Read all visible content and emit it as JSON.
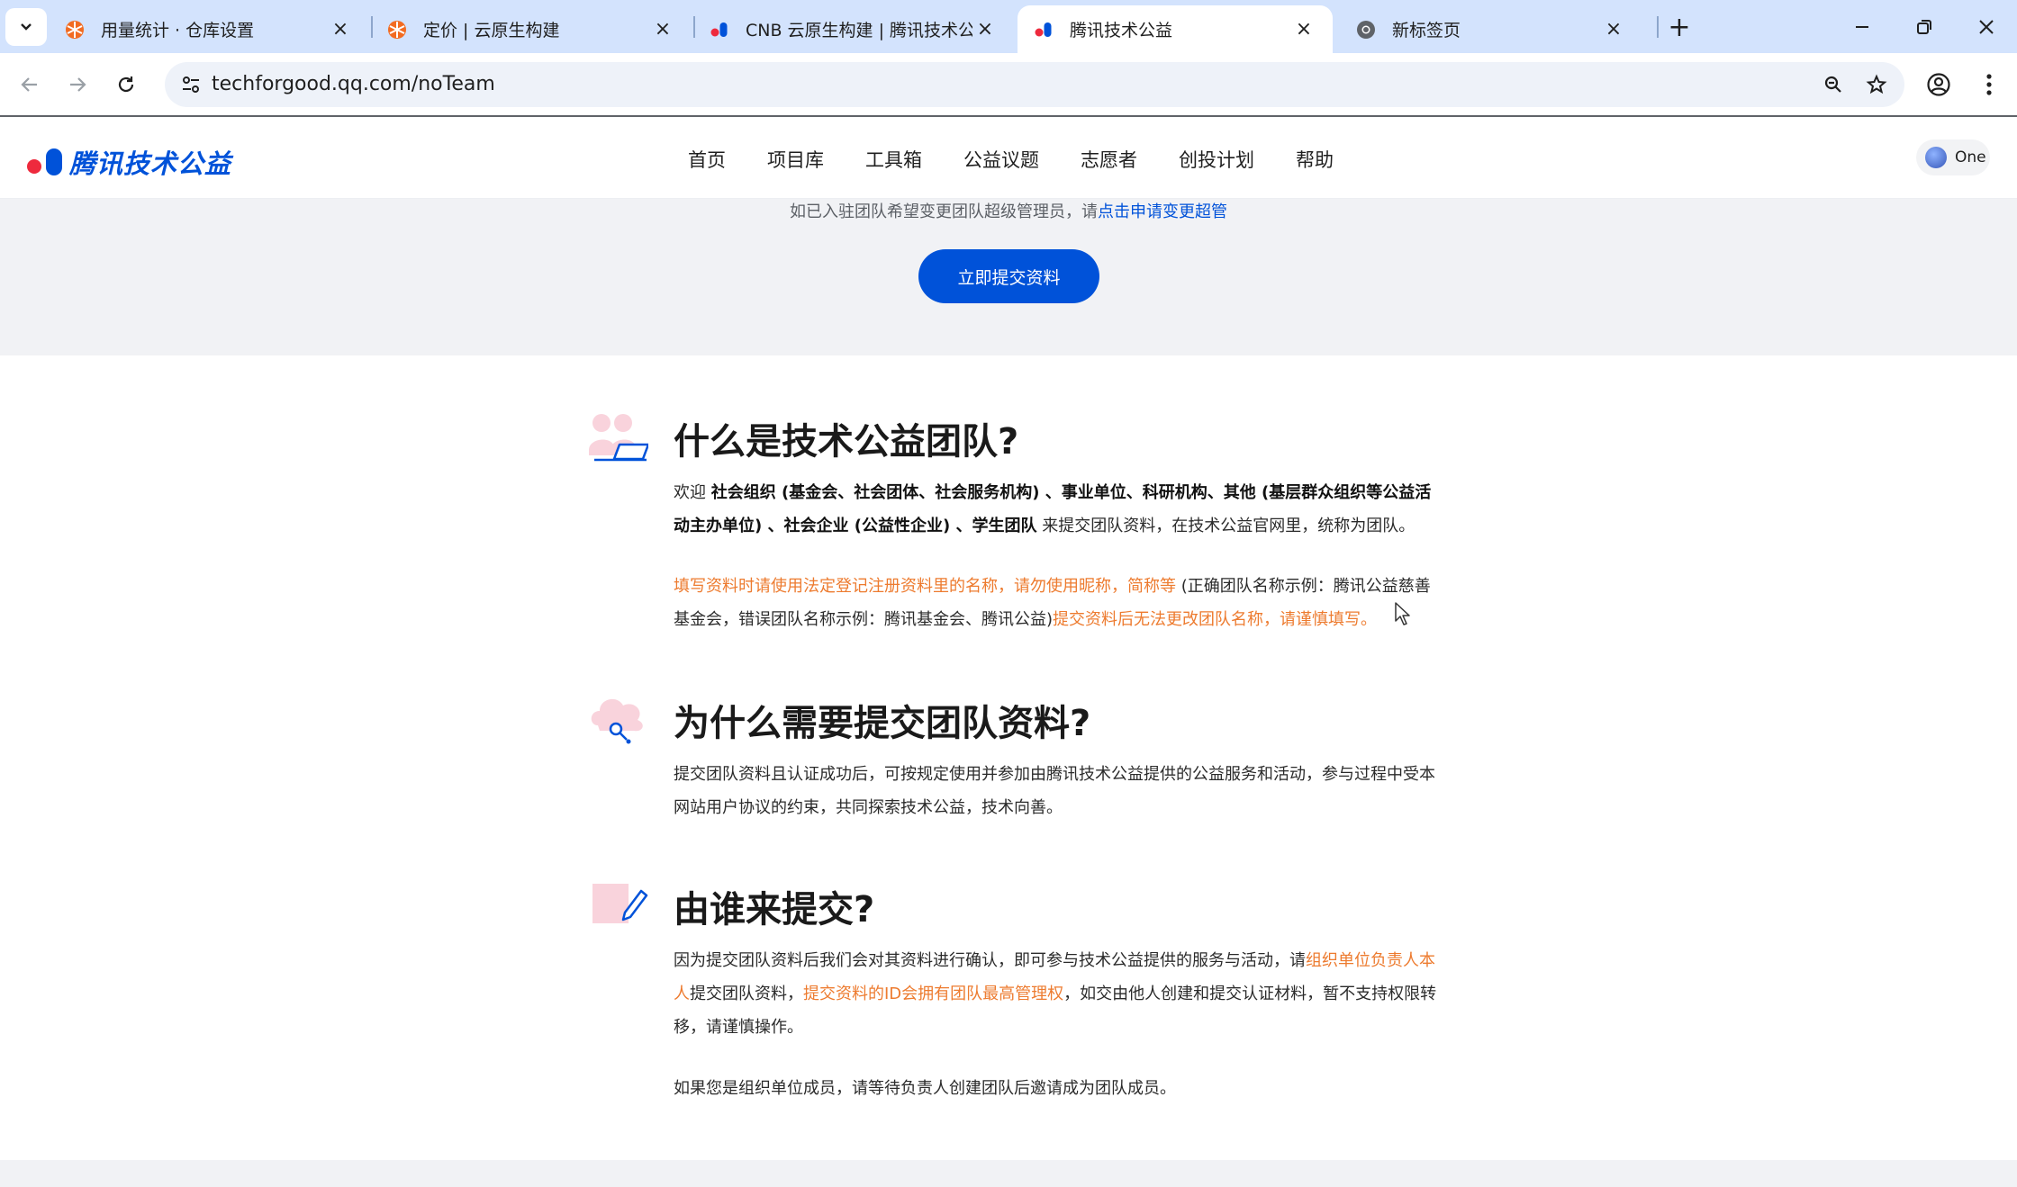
{
  "browser": {
    "tabs": [
      {
        "title": "用量统计 · 仓库设置",
        "favicon": "cnb-orange-icon",
        "active": false
      },
      {
        "title": "定价 | 云原生构建",
        "favicon": "cnb-orange-icon",
        "active": false
      },
      {
        "title": "CNB 云原生构建 | 腾讯技术公益",
        "favicon": "tencent-tech-icon",
        "active": false
      },
      {
        "title": "腾讯技术公益",
        "favicon": "tencent-tech-icon",
        "active": true
      },
      {
        "title": "新标签页",
        "favicon": "chrome-icon",
        "active": false
      }
    ],
    "url": "techforgood.qq.com/noTeam"
  },
  "site": {
    "brand": "腾讯技术公益",
    "nav": [
      "首页",
      "项目库",
      "工具箱",
      "公益议题",
      "志愿者",
      "创投计划",
      "帮助"
    ],
    "user_name": "One"
  },
  "band": {
    "note_prefix": "如已入驻团队希望变更团队超级管理员，",
    "note_link_prefix": "请",
    "note_link": "点击申请变更超管",
    "submit_label": "立即提交资料"
  },
  "sections": {
    "what": {
      "title": "什么是技术公益团队?",
      "p1_prefix": "欢迎 ",
      "p1_bold": "社会组织 (基金会、社会团体、社会服务机构) 、事业单位、科研机构、其他 (基层群众组织等公益活动主办单位) 、社会企业 (公益性企业) 、学生团队",
      "p1_suffix": " 来提交团队资料，在技术公益官网里，统称为团队。",
      "p2_orange1": "填写资料时请使用法定登记注册资料里的名称，请勿使用昵称，简称等",
      "p2_middle": " (正确团队名称示例：腾讯公益慈善基金会，错误团队名称示例：腾讯基金会、腾讯公益)",
      "p2_orange2": "提交资料后无法更改团队名称，请谨慎填写。"
    },
    "why": {
      "title": "为什么需要提交团队资料?",
      "p1": "提交团队资料且认证成功后，可按规定使用并参加由腾讯技术公益提供的公益服务和活动，参与过程中受本网站用户协议的约束，共同探索技术公益，技术向善。"
    },
    "who": {
      "title": "由谁来提交?",
      "p1_a": "因为提交团队资料后我们会对其资料进行确认，即可参与技术公益提供的服务与活动，请",
      "p1_orange1": "组织单位负责人本人",
      "p1_b": "提交团队资料，",
      "p1_orange2": "提交资料的ID会拥有团队最高管理权",
      "p1_c": "，如交由他人创建和提交认证材料，暂不支持权限转移，请谨慎操作。",
      "p2": "如果您是组织单位成员，请等待负责人创建团队后邀请成为团队成员。"
    }
  },
  "colors": {
    "brand_blue": "#0052d9",
    "brand_red": "#ee2a3d",
    "warning_orange": "#ed7b2f",
    "tabstrip": "#d3e3fd"
  }
}
